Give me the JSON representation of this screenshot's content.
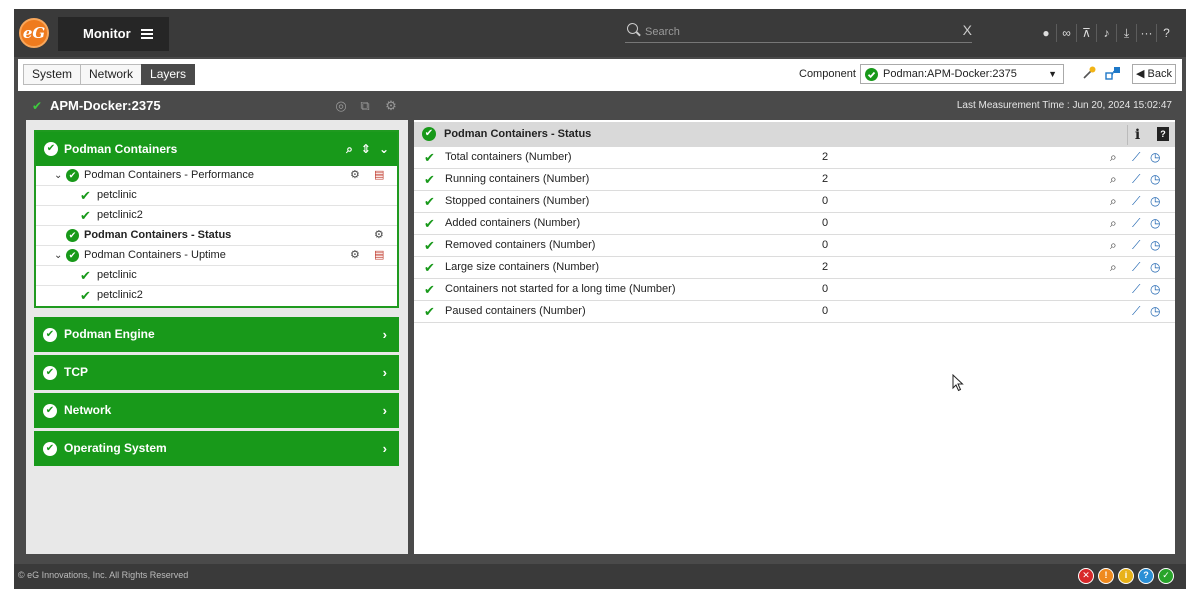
{
  "topbar": {
    "logo_label": "eG logo",
    "monitor_label": "Monitor",
    "search_placeholder": "Search",
    "search_clear": "X",
    "icons": [
      "user-icon",
      "link-icon",
      "presentation-icon",
      "bell-icon",
      "download-icon",
      "more-icon",
      "help-icon"
    ]
  },
  "tabs": [
    {
      "label": "System",
      "active": false
    },
    {
      "label": "Network",
      "active": false
    },
    {
      "label": "Layers",
      "active": true
    }
  ],
  "component": {
    "label": "Component",
    "selected": "Podman:APM-Docker:2375"
  },
  "back_label": "Back",
  "title": {
    "name": "APM-Docker:2375",
    "last_measurement": "Last Measurement Time : Jun 20, 2024 15:02:47"
  },
  "layers": {
    "open_group": {
      "label": "Podman Containers",
      "tests": [
        {
          "label": "Podman Containers - Performance",
          "children": [
            "petclinic",
            "petclinic2"
          ]
        },
        {
          "label": "Podman Containers - Status",
          "children": []
        },
        {
          "label": "Podman Containers - Uptime",
          "children": [
            "petclinic",
            "petclinic2"
          ]
        }
      ]
    },
    "groups": [
      "Podman Engine",
      "TCP",
      "Network",
      "Operating System"
    ]
  },
  "measures": {
    "header": "Podman Containers - Status",
    "info_label": "i",
    "help_label": "?",
    "rows": [
      {
        "name": "Total containers (Number)",
        "value": "2",
        "search": true
      },
      {
        "name": "Running containers (Number)",
        "value": "2",
        "search": true
      },
      {
        "name": "Stopped containers (Number)",
        "value": "0",
        "search": true
      },
      {
        "name": "Added containers (Number)",
        "value": "0",
        "search": true
      },
      {
        "name": "Removed containers (Number)",
        "value": "0",
        "search": true
      },
      {
        "name": "Large size containers (Number)",
        "value": "2",
        "search": true
      },
      {
        "name": "Containers not started for a long time (Number)",
        "value": "0",
        "search": false
      },
      {
        "name": "Paused containers (Number)",
        "value": "0",
        "search": false
      }
    ]
  },
  "footer": {
    "copyright": "© eG Innovations, Inc. All Rights Reserved",
    "status_icons": [
      {
        "name": "critical-icon",
        "glyph": "✕",
        "color": "#d8282a"
      },
      {
        "name": "major-icon",
        "glyph": "!",
        "color": "#ef8a1e"
      },
      {
        "name": "minor-icon",
        "glyph": "i",
        "color": "#e8b219"
      },
      {
        "name": "unknown-icon",
        "glyph": "?",
        "color": "#2a8fd6"
      },
      {
        "name": "normal-icon",
        "glyph": "✓",
        "color": "#28a42a"
      }
    ]
  }
}
